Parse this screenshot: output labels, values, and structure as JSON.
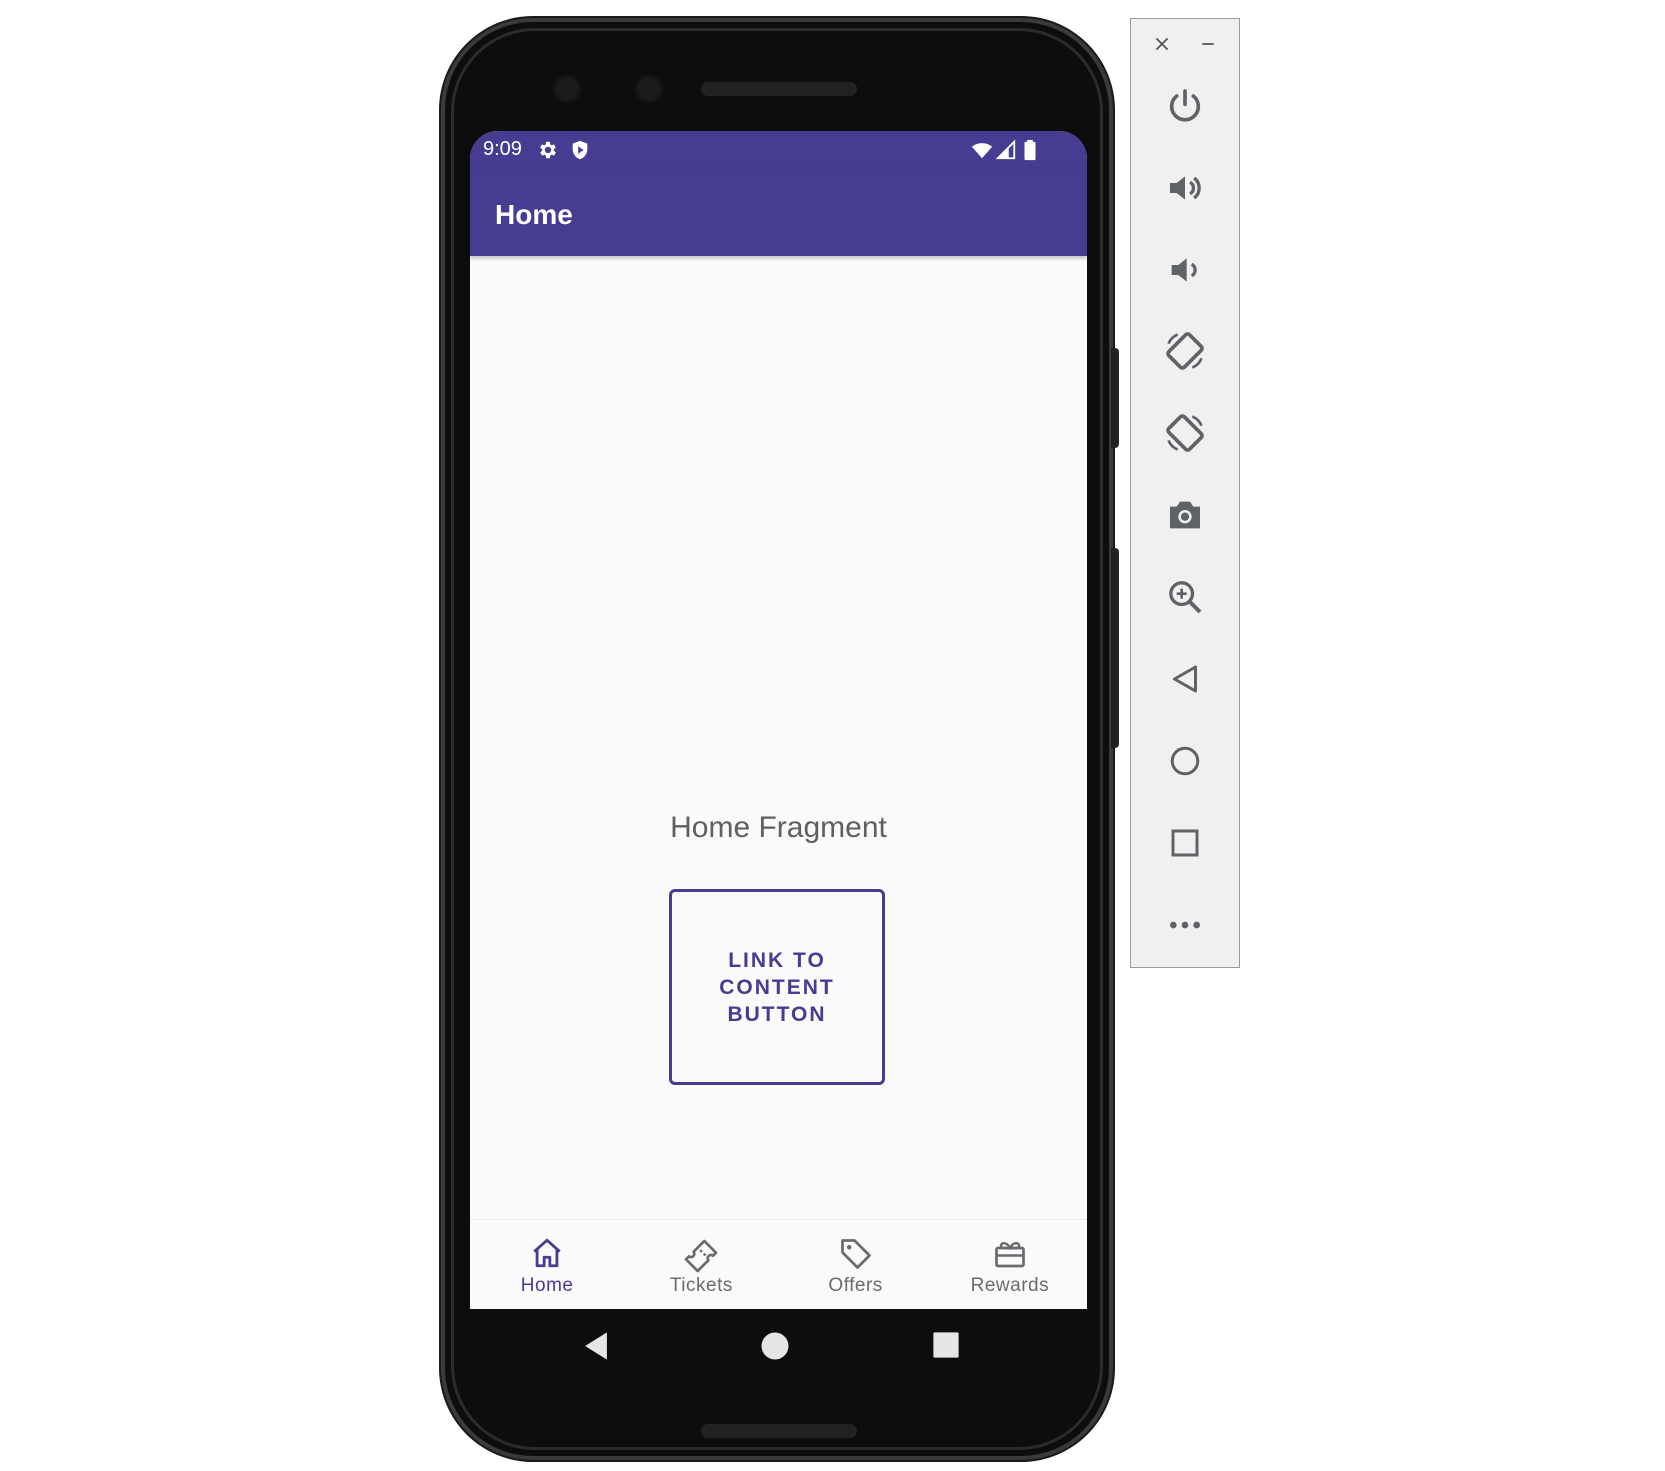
{
  "status_bar": {
    "time": "9:09"
  },
  "app_bar": {
    "title": "Home"
  },
  "content": {
    "title": "Home Fragment",
    "button_label": "LINK TO CONTENT BUTTON"
  },
  "bottom_nav": {
    "items": [
      {
        "label": "Home",
        "icon": "home-icon",
        "active": true
      },
      {
        "label": "Tickets",
        "icon": "ticket-icon",
        "active": false
      },
      {
        "label": "Offers",
        "icon": "tag-icon",
        "active": false
      },
      {
        "label": "Rewards",
        "icon": "gift-icon",
        "active": false
      }
    ]
  },
  "system_nav": [
    "back-icon",
    "home-circle-icon",
    "recents-square-icon"
  ],
  "emulator_panel": {
    "window_controls": [
      "close-icon",
      "minimize-icon"
    ],
    "buttons": [
      "power-icon",
      "volume-up-icon",
      "volume-down-icon",
      "rotate-left-icon",
      "rotate-right-icon",
      "camera-icon",
      "zoom-icon",
      "back-icon",
      "home-icon",
      "overview-icon",
      "more-icon"
    ]
  },
  "colors": {
    "primary": "#463c92",
    "screen_bg": "#fafafa",
    "panel_bg": "#f0f0f0",
    "icon_gray": "#6a6a70"
  }
}
